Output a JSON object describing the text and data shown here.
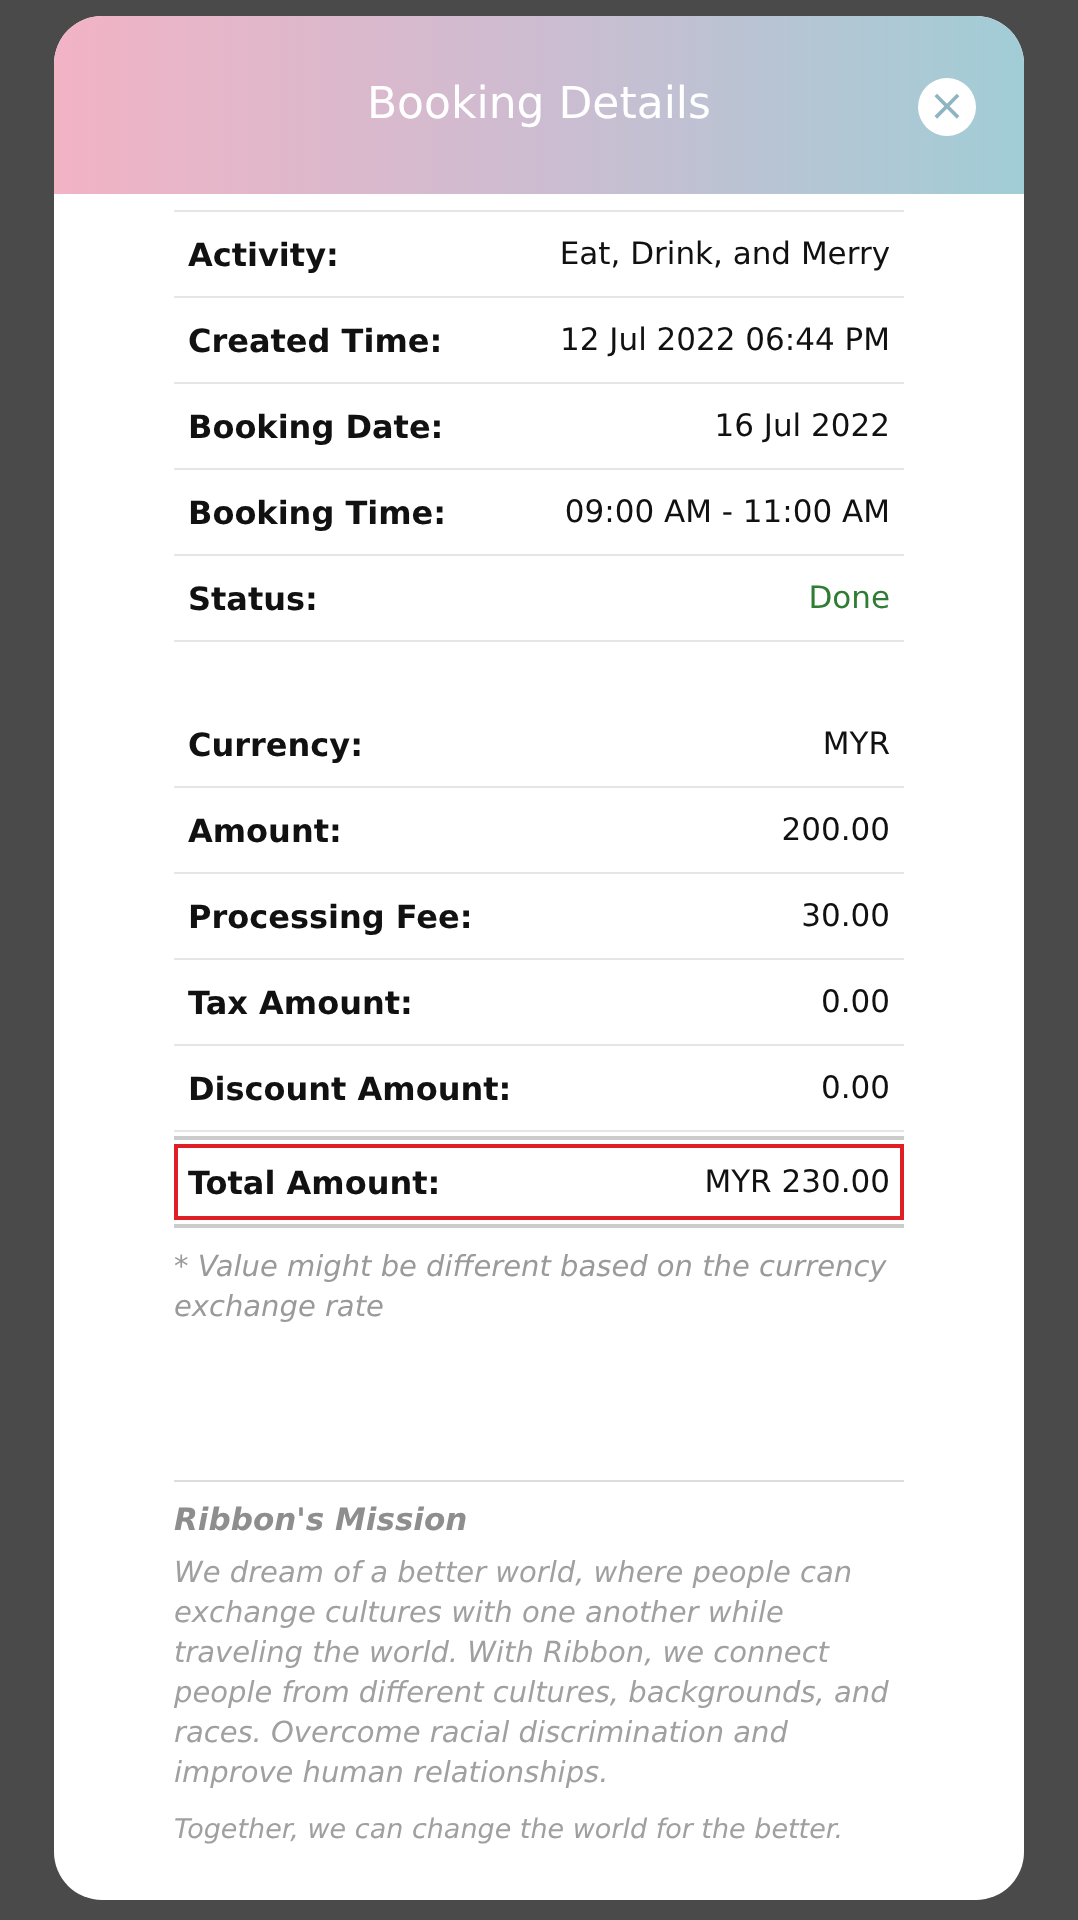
{
  "modal": {
    "title": "Booking Details",
    "close": "×"
  },
  "booking_rows": [
    {
      "label": "Activity:",
      "value": "Eat, Drink, and Merry"
    },
    {
      "label": "Created Time:",
      "value": "12 Jul 2022 06:44 PM"
    },
    {
      "label": "Booking Date:",
      "value": "16 Jul 2022"
    },
    {
      "label": "Booking Time:",
      "value": "09:00 AM - 11:00 AM"
    },
    {
      "label": "Status:",
      "value": "Done",
      "color": "#2e7d32"
    }
  ],
  "payment_rows": [
    {
      "label": "Currency:",
      "value": "MYR"
    },
    {
      "label": "Amount:",
      "value": "200.00"
    },
    {
      "label": "Processing Fee:",
      "value": "30.00"
    },
    {
      "label": "Tax Amount:",
      "value": "0.00"
    },
    {
      "label": "Discount Amount:",
      "value": "0.00"
    }
  ],
  "total": {
    "label": "Total Amount:",
    "value": "MYR 230.00",
    "highlighted": true
  },
  "note": "* Value might be different based on the currency exchange rate",
  "mission": {
    "title": "Ribbon's Mission",
    "body": "We dream of a better world, where people can exchange cultures with one another while traveling the world. With Ribbon, we connect people from different cultures, backgrounds, and races. Overcome racial discrimination and improve human relationships.",
    "closing": "Together, we can change the world for the better."
  }
}
